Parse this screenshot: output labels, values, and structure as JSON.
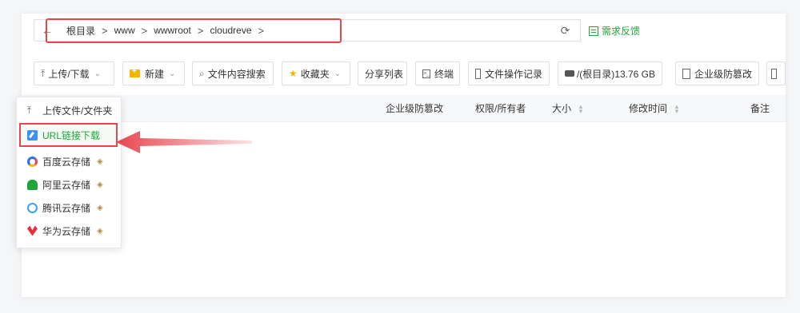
{
  "addressbar": {
    "back_icon": "arrow-left-icon",
    "crumbs": [
      "根目录",
      "www",
      "wwwroot",
      "cloudreve"
    ],
    "separator": ">",
    "refresh_icon": "refresh-icon"
  },
  "feedback": {
    "label": "需求反馈",
    "color": "#20a53a"
  },
  "toolbar": {
    "upload": "上传/下载",
    "new": "新建",
    "search": "文件内容搜索",
    "favorites": "收藏夹",
    "share_list": "分享列表",
    "terminal": "终端",
    "file_log": "文件操作记录",
    "disk": "/(根目录)13.76 GB",
    "tamper": "企业级防篡改"
  },
  "table": {
    "col_tamper": "企业级防篡改",
    "col_perm": "权限/所有者",
    "col_size": "大小",
    "col_mtime": "修改时间",
    "col_note": "备注"
  },
  "menu": {
    "upload_file": "上传文件/文件夹",
    "url_download": "URL链接下载",
    "baidu": "百度云存储",
    "aliyun": "阿里云存储",
    "tencent": "腾讯云存储",
    "huawei": "华为云存储"
  },
  "colors": {
    "highlight": "#e8454e",
    "accent_green": "#20a53a"
  }
}
